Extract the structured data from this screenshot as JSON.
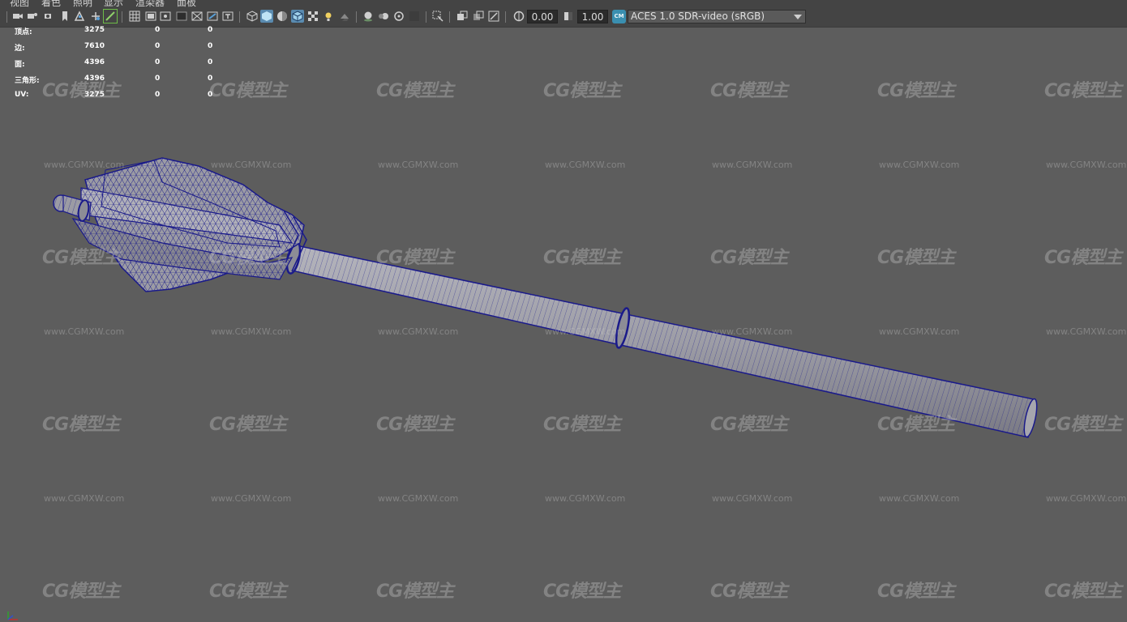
{
  "menu": [
    {
      "label": "视图"
    },
    {
      "label": "着色"
    },
    {
      "label": "照明"
    },
    {
      "label": "显示"
    },
    {
      "label": "渲染器"
    },
    {
      "label": "面板"
    }
  ],
  "toolbar": {
    "exposure_value": "0.00",
    "gamma_value": "1.00",
    "color_management_badge": "CM",
    "color_space": "ACES 1.0 SDR-video (sRGB)"
  },
  "hud": {
    "rows": [
      {
        "label": "顶点:",
        "a": "3275",
        "b": "0",
        "c": "0"
      },
      {
        "label": "边:",
        "a": "7610",
        "b": "0",
        "c": "0"
      },
      {
        "label": "面:",
        "a": "4396",
        "b": "0",
        "c": "0"
      },
      {
        "label": "三角形:",
        "a": "4396",
        "b": "0",
        "c": "0"
      },
      {
        "label": "UV:",
        "a": "3275",
        "b": "0",
        "c": "0"
      }
    ]
  },
  "watermark": {
    "logo": "CG模型主",
    "url": "www.CGMXW.com"
  },
  "colors": {
    "viewport_bg": "#5d5d5d",
    "wireframe": "#1a1a8a",
    "mesh_fill": "#9a9aa4",
    "toolbar_bg": "#444444",
    "active_icon": "#5a8bb0"
  }
}
